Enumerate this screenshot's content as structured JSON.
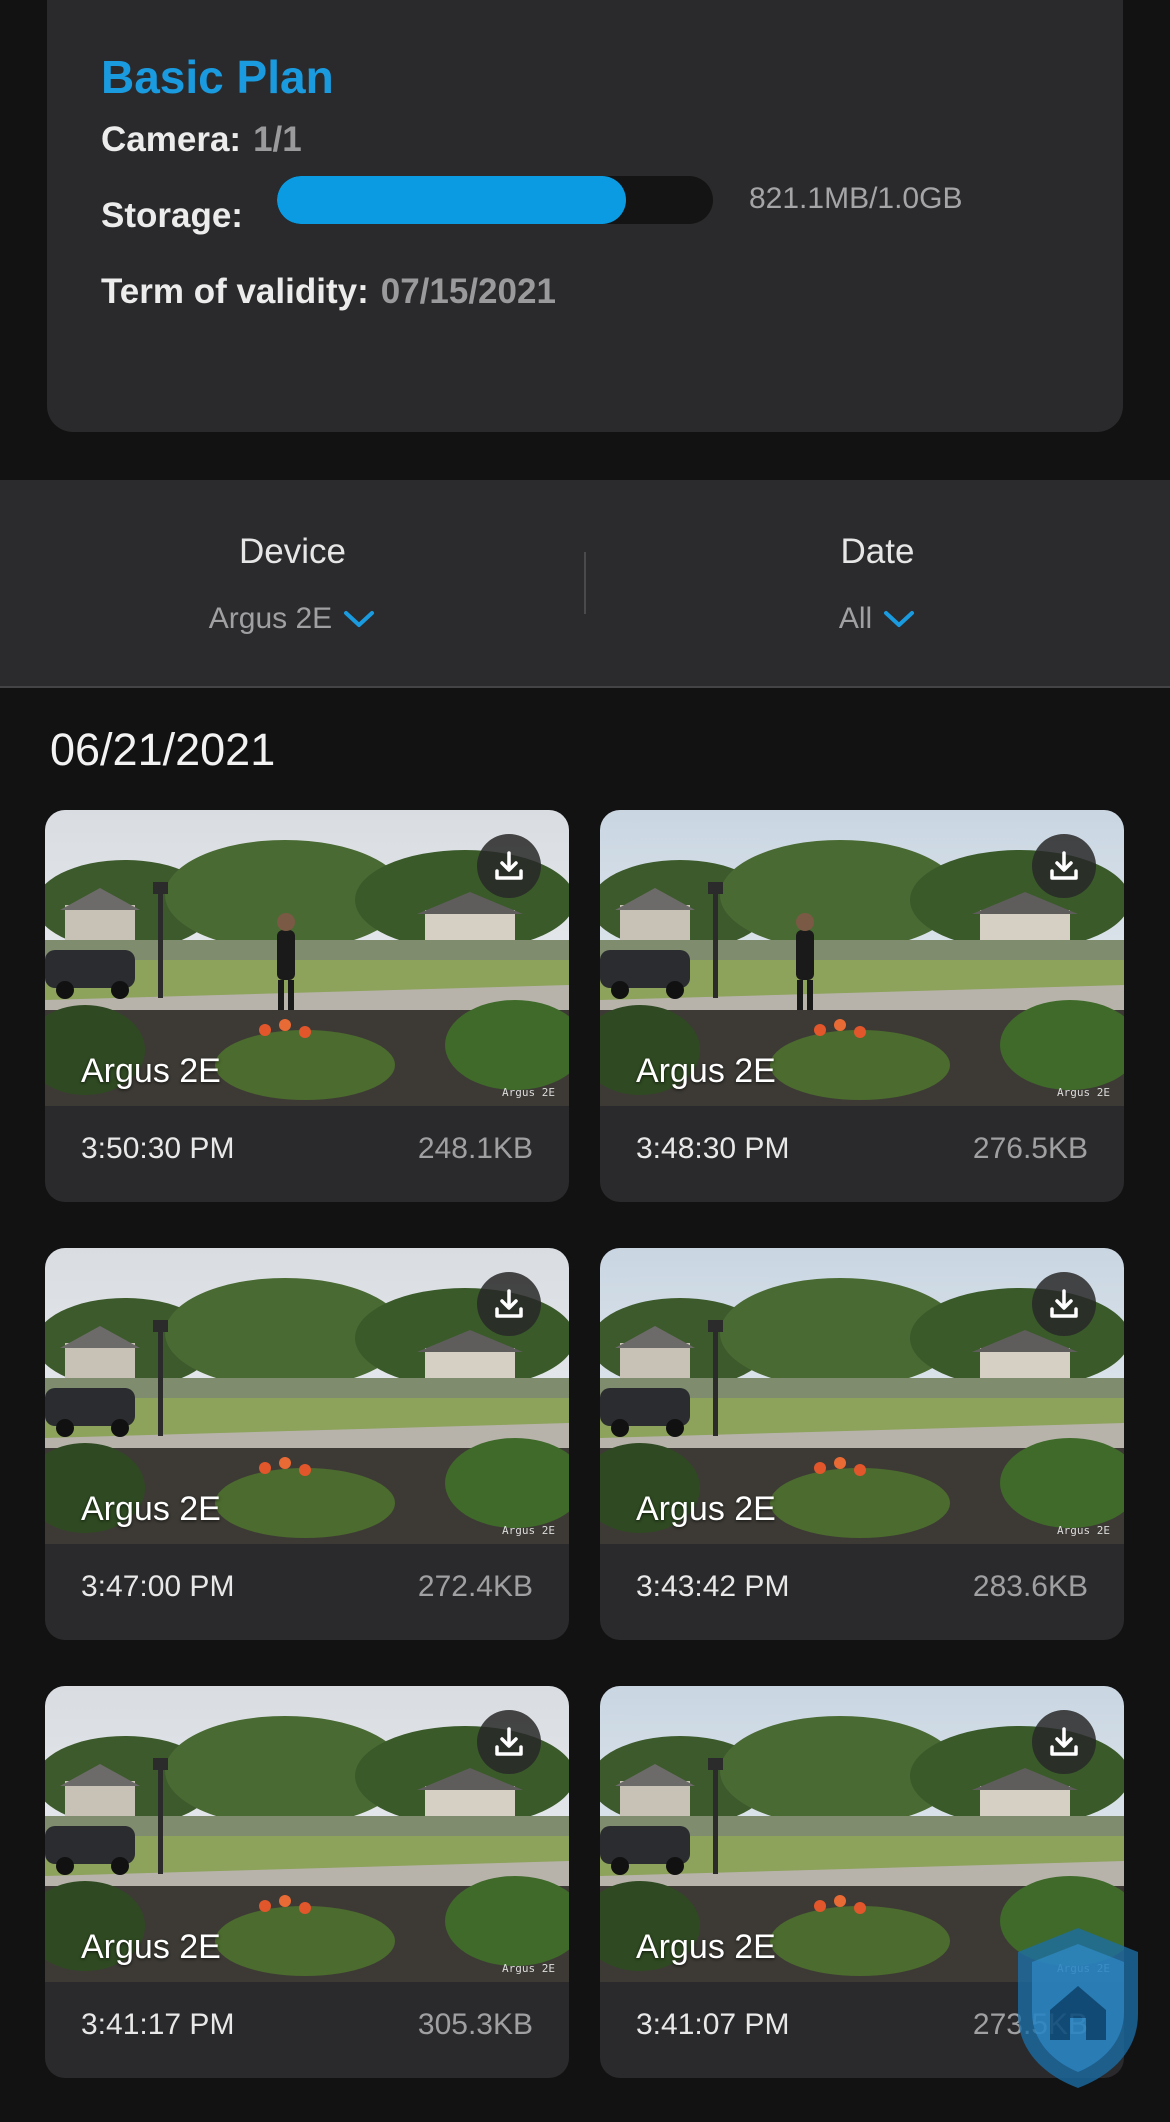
{
  "plan": {
    "title": "Basic Plan",
    "camera_label": "Camera:",
    "camera_value": "1/1",
    "storage_label": "Storage:",
    "storage_used_fraction": 0.8,
    "storage_text": "821.1MB/1.0GB",
    "term_label": "Term of validity:",
    "term_value": "07/15/2021"
  },
  "filters": {
    "device_label": "Device",
    "device_value": "Argus 2E",
    "date_label": "Date",
    "date_value": "All"
  },
  "date_heading": "06/21/2021",
  "clips": [
    {
      "camera": "Argus 2E",
      "watermark": "Argus 2E",
      "time": "3:50:30 PM",
      "size": "248.1KB"
    },
    {
      "camera": "Argus 2E",
      "watermark": "Argus 2E",
      "time": "3:48:30 PM",
      "size": "276.5KB"
    },
    {
      "camera": "Argus 2E",
      "watermark": "Argus 2E",
      "time": "3:47:00 PM",
      "size": "272.4KB"
    },
    {
      "camera": "Argus 2E",
      "watermark": "Argus 2E",
      "time": "3:43:42 PM",
      "size": "283.6KB"
    },
    {
      "camera": "Argus 2E",
      "watermark": "Argus 2E",
      "time": "3:41:17 PM",
      "size": "305.3KB"
    },
    {
      "camera": "Argus 2E",
      "watermark": "Argus 2E",
      "time": "3:41:07 PM",
      "size": "273.5KB"
    }
  ],
  "colors": {
    "accent": "#1a9be0",
    "storage_fill": "#0a9be2",
    "card_bg": "#2a2a2c",
    "page_bg": "#121212"
  },
  "icons": {
    "download": "download-icon",
    "chevron": "chevron-down-icon",
    "badge": "shield-logo-icon"
  }
}
